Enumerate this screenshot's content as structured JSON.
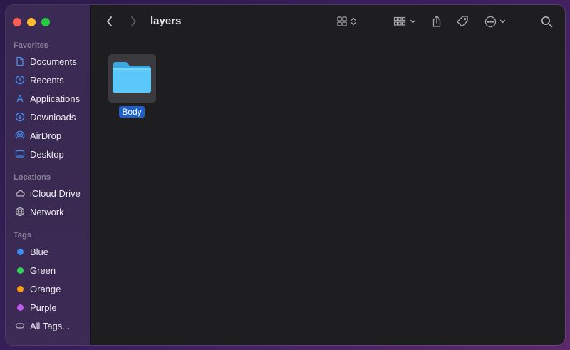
{
  "window": {
    "title": "layers"
  },
  "sidebar": {
    "favorites_title": "Favorites",
    "favorites": [
      {
        "label": "Documents",
        "icon": "document-icon"
      },
      {
        "label": "Recents",
        "icon": "clock-icon"
      },
      {
        "label": "Applications",
        "icon": "applications-icon"
      },
      {
        "label": "Downloads",
        "icon": "download-icon"
      },
      {
        "label": "AirDrop",
        "icon": "airdrop-icon"
      },
      {
        "label": "Desktop",
        "icon": "desktop-icon"
      }
    ],
    "locations_title": "Locations",
    "locations": [
      {
        "label": "iCloud Drive",
        "icon": "cloud-icon"
      },
      {
        "label": "Network",
        "icon": "globe-icon"
      }
    ],
    "tags_title": "Tags",
    "tags": [
      {
        "label": "Blue",
        "color": "#3b8cf5"
      },
      {
        "label": "Green",
        "color": "#30d158"
      },
      {
        "label": "Orange",
        "color": "#ff9f0a"
      },
      {
        "label": "Purple",
        "color": "#bf5af2"
      },
      {
        "label": "All Tags...",
        "icon": "all-tags-icon"
      }
    ]
  },
  "content": {
    "items": [
      {
        "name": "Body",
        "kind": "folder",
        "selected": true
      }
    ]
  },
  "colors": {
    "accent": "#1f5fc9",
    "folder": "#5ac8fa"
  }
}
